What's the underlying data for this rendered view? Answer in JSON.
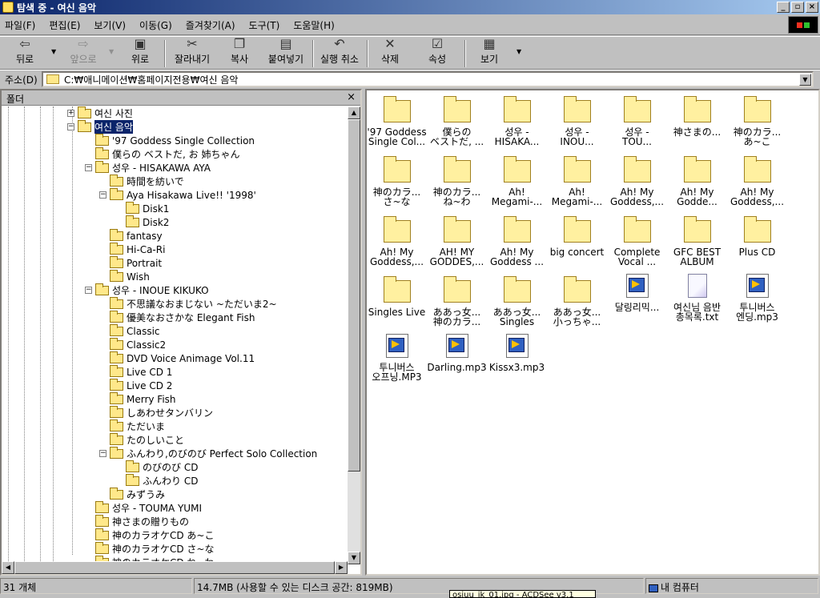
{
  "window": {
    "title": "탐색 중 - 여신 음악"
  },
  "menu": [
    "파일(F)",
    "편집(E)",
    "보기(V)",
    "이동(G)",
    "즐겨찾기(A)",
    "도구(T)",
    "도움말(H)"
  ],
  "toolbar": {
    "back": "뒤로",
    "forward": "앞으로",
    "up": "위로",
    "cut": "잘라내기",
    "copy": "복사",
    "paste": "붙여넣기",
    "undo": "실행 취소",
    "delete": "삭제",
    "properties": "속성",
    "views": "보기"
  },
  "address": {
    "label": "주소(D)",
    "value": "C:₩애니메이션₩홈페이지전용₩여신 음악"
  },
  "folder_pane": {
    "title": "폴더",
    "close": "×"
  },
  "tree": [
    {
      "label": "여신 사진",
      "level": 0,
      "exp": "+"
    },
    {
      "label": "여신 음악",
      "level": 0,
      "exp": "−",
      "selected": true
    },
    {
      "label": "'97 Goddess Single Collection",
      "level": 1
    },
    {
      "label": "僕らの ベストだ, お 姉ちゃん",
      "level": 1
    },
    {
      "label": "성우 - HISAKAWA AYA",
      "level": 1,
      "exp": "−"
    },
    {
      "label": "時間を紡いで",
      "level": 2
    },
    {
      "label": "Aya Hisakawa Live!! '1998'",
      "level": 2,
      "exp": "−"
    },
    {
      "label": "Disk1",
      "level": 3
    },
    {
      "label": "Disk2",
      "level": 3
    },
    {
      "label": "fantasy",
      "level": 2
    },
    {
      "label": "Hi-Ca-Ri",
      "level": 2
    },
    {
      "label": "Portrait",
      "level": 2
    },
    {
      "label": "Wish",
      "level": 2
    },
    {
      "label": "성우 - INOUE KIKUKO",
      "level": 1,
      "exp": "−"
    },
    {
      "label": "不思議なおまじない ~ただいま2~",
      "level": 2
    },
    {
      "label": "優美なおさかな Elegant Fish",
      "level": 2
    },
    {
      "label": "Classic",
      "level": 2
    },
    {
      "label": "Classic2",
      "level": 2
    },
    {
      "label": "DVD Voice Animage Vol.11",
      "level": 2
    },
    {
      "label": "Live CD 1",
      "level": 2
    },
    {
      "label": "Live CD 2",
      "level": 2
    },
    {
      "label": "Merry Fish",
      "level": 2
    },
    {
      "label": "しあわせタンバリン",
      "level": 2
    },
    {
      "label": "ただいま",
      "level": 2
    },
    {
      "label": "たのしいこと",
      "level": 2
    },
    {
      "label": "ふんわり,のびのび Perfect Solo Collection",
      "level": 2,
      "exp": "−"
    },
    {
      "label": "のびのび CD",
      "level": 3
    },
    {
      "label": "ふんわり CD",
      "level": 3
    },
    {
      "label": "みずうみ",
      "level": 2
    },
    {
      "label": "성우 - TOUMA YUMI",
      "level": 1
    },
    {
      "label": "神さまの贈りもの",
      "level": 1
    },
    {
      "label": "神のカラオケCD あ~こ",
      "level": 1
    },
    {
      "label": "神のカラオケCD さ~な",
      "level": 1
    },
    {
      "label": "神のカラオケCD ね~わ",
      "level": 1
    }
  ],
  "items": [
    {
      "l1": "'97 Goddess",
      "l2": "Single Col...",
      "type": "folder"
    },
    {
      "l1": "僕らの",
      "l2": "ベストだ, ...",
      "type": "folder"
    },
    {
      "l1": "성우 -",
      "l2": "HISAKA...",
      "type": "folder"
    },
    {
      "l1": "성우 -",
      "l2": "INOU...",
      "type": "folder"
    },
    {
      "l1": "성우 -",
      "l2": "TOU...",
      "type": "folder"
    },
    {
      "l1": "神さまの...",
      "l2": "",
      "type": "folder"
    },
    {
      "l1": "神のカラ...",
      "l2": "あ~こ",
      "type": "folder"
    },
    {
      "l1": "神のカラ...",
      "l2": "さ~な",
      "type": "folder"
    },
    {
      "l1": "神のカラ...",
      "l2": "ね~わ",
      "type": "folder"
    },
    {
      "l1": "Ah!",
      "l2": "Megami-...",
      "type": "folder"
    },
    {
      "l1": "Ah!",
      "l2": "Megami-...",
      "type": "folder"
    },
    {
      "l1": "Ah! My",
      "l2": "Goddess,...",
      "type": "folder"
    },
    {
      "l1": "Ah! My",
      "l2": "Godde...",
      "type": "folder"
    },
    {
      "l1": "Ah! My",
      "l2": "Goddess,...",
      "type": "folder"
    },
    {
      "l1": "Ah! My",
      "l2": "Goddess,...",
      "type": "folder"
    },
    {
      "l1": "AH! MY",
      "l2": "GODDES,...",
      "type": "folder"
    },
    {
      "l1": "Ah! My",
      "l2": "Goddess ...",
      "type": "folder"
    },
    {
      "l1": "big concert",
      "l2": "",
      "type": "folder"
    },
    {
      "l1": "Complete",
      "l2": "Vocal ...",
      "type": "folder"
    },
    {
      "l1": "GFC BEST",
      "l2": "ALBUM",
      "type": "folder"
    },
    {
      "l1": "Plus CD",
      "l2": "",
      "type": "folder"
    },
    {
      "l1": "Singles Live",
      "l2": "",
      "type": "folder"
    },
    {
      "l1": "ああっ女...",
      "l2": "神のカラ...",
      "type": "folder"
    },
    {
      "l1": "ああっ女...",
      "l2": "Singles",
      "type": "folder"
    },
    {
      "l1": "ああっ女...",
      "l2": "小っちゃ...",
      "type": "folder"
    },
    {
      "l1": "달링리믹...",
      "l2": "",
      "type": "mp3"
    },
    {
      "l1": "여신님 음반",
      "l2": "총목록.txt",
      "type": "txt"
    },
    {
      "l1": "투니버스",
      "l2": "엔딩.mp3",
      "type": "mp3"
    },
    {
      "l1": "투니버스",
      "l2": "오프닝.MP3",
      "type": "mp3"
    },
    {
      "l1": "Darling.mp3",
      "l2": "",
      "type": "mp3"
    },
    {
      "l1": "Kissx3.mp3",
      "l2": "",
      "type": "mp3"
    }
  ],
  "status": {
    "count": "31 개체",
    "size": "14.7MB (사용할 수 있는 디스크 공간: 819MB)",
    "location": "내 컴퓨터",
    "tooltip": "osiuu_ik_01.jpg - ACDSee v3.1"
  }
}
